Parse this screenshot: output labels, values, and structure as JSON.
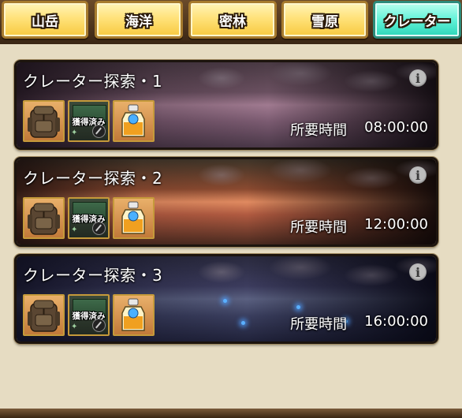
{
  "tabs": [
    {
      "label": "山岳",
      "active": false
    },
    {
      "label": "海洋",
      "active": false
    },
    {
      "label": "密林",
      "active": false
    },
    {
      "label": "雪原",
      "active": false
    },
    {
      "label": "クレーター",
      "active": true
    }
  ],
  "info_glyph": "i",
  "acquired_badge": "獲得済み",
  "time_label": "所要時間",
  "expeditions": [
    {
      "title": "クレーター探索・1",
      "duration": "08:00:00",
      "theme": "purple-dusk"
    },
    {
      "title": "クレーター探索・2",
      "duration": "12:00:00",
      "theme": "sunset-red"
    },
    {
      "title": "クレーター探索・3",
      "duration": "16:00:00",
      "theme": "night-blue"
    }
  ],
  "reward_items": [
    {
      "name": "backpack-icon"
    },
    {
      "name": "book-icon"
    },
    {
      "name": "potion-bottle-icon"
    }
  ],
  "colors": {
    "tab_gold": "#ffe27a",
    "tab_active_teal": "#62f2d8",
    "panel_bg": "#e6dcc2",
    "card_border": "#1c140e"
  }
}
